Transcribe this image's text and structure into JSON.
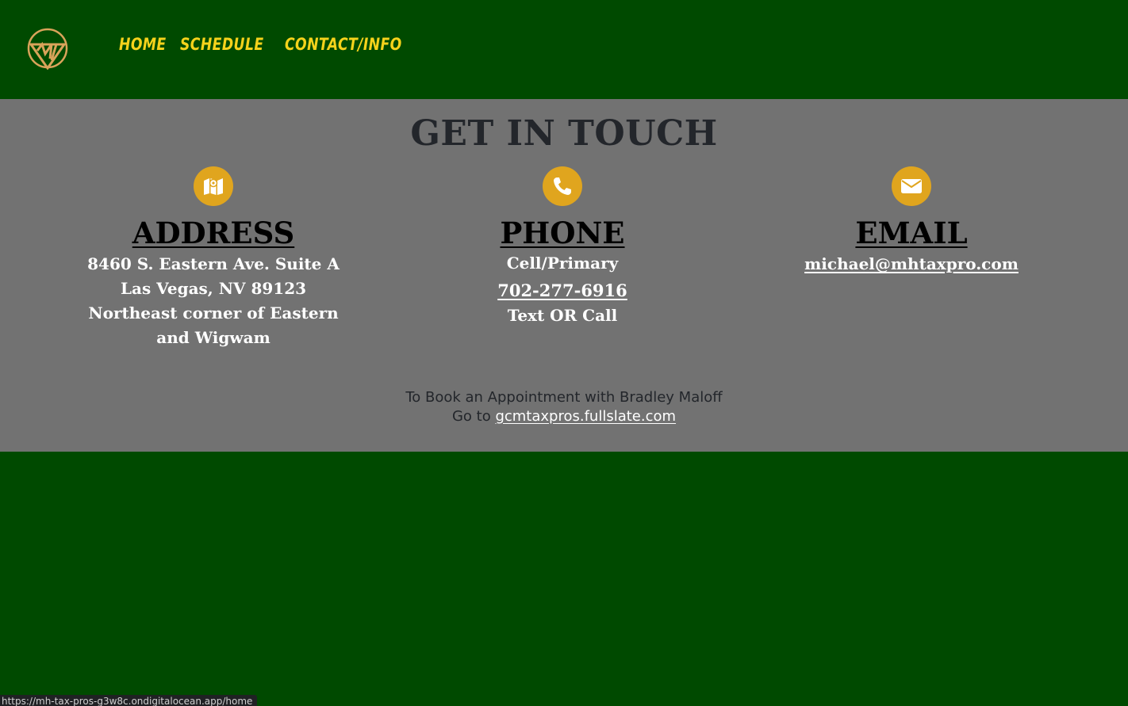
{
  "nav": {
    "logo_icon": "mh-triangle-logo",
    "links": [
      "HOME",
      "SCHEDULE",
      "CONTACT/INFO"
    ]
  },
  "contact": {
    "title": "GET IN TOUCH",
    "address": {
      "icon": "map-icon",
      "heading": "ADDRESS",
      "line1": "8460 S. Eastern Ave. Suite A",
      "line2": "Las Vegas, NV 89123",
      "line3": "Northeast corner of Eastern and Wigwam"
    },
    "phone": {
      "icon": "phone-icon",
      "heading": "PHONE",
      "label": "Cell/Primary",
      "number": "702-277-6916",
      "note": "Text OR Call"
    },
    "email": {
      "icon": "envelope-icon",
      "heading": "EMAIL",
      "address": "michael@mhtaxpro.com"
    },
    "booking": {
      "line1": "To Book an Appointment with Bradley Maloff",
      "prefix": "Go to",
      "link": "gcmtaxpros.fullslate.com"
    }
  },
  "status_bar": {
    "url": "https://mh-tax-pros-g3w8c.ondigitalocean.app/home"
  },
  "colors": {
    "nav_bg": "#004a00",
    "section_bg": "#727272",
    "accent": "#e0a51e",
    "nav_link": "#f5d21b"
  }
}
